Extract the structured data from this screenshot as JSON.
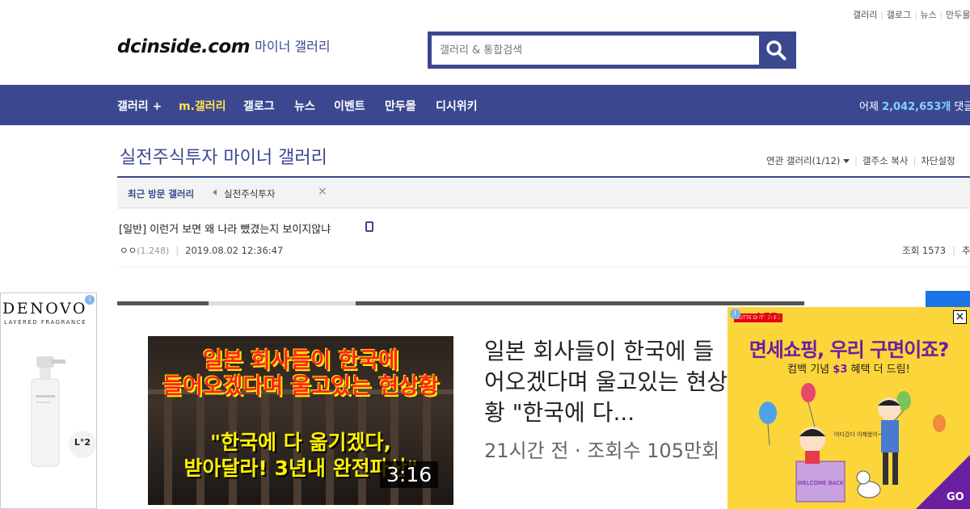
{
  "top_links": [
    "갤러리",
    "갤로그",
    "뉴스",
    "만두몰"
  ],
  "logo": {
    "main": "dcinside.com",
    "sub": "마이너 갤러리"
  },
  "search": {
    "placeholder": "갤러리 & 통합검색",
    "icon": "search-icon"
  },
  "nav": {
    "items": [
      "갤러리 +",
      "m.갤러리",
      "갤로그",
      "뉴스",
      "이벤트",
      "만두몰",
      "디시위키"
    ],
    "stats_prefix": "어제",
    "stats_count": "2,042,653개",
    "stats_suffix": "댓글",
    "active_color": "#ffe14d"
  },
  "gallery": {
    "title": "실전주식투자 마이너 갤러리",
    "tools": [
      "연관 갤러리(1/12)",
      "갤주소 복사",
      "차단설정"
    ]
  },
  "recent": {
    "label": "최근 방문 갤러리",
    "item": "실전주식투자",
    "close": "×"
  },
  "post": {
    "title": "[일반] 이런거 보면 왜 나라 뺐겼는지 보이지않냐",
    "author": "ㅇㅇ",
    "ip": "(1.248)",
    "date": "2019.08.02 12:36:47",
    "views_label": "조회 1573",
    "extra": "추"
  },
  "ad_left": {
    "brand": "DENOVO",
    "sub": "LAYERED FRAGRANCE",
    "badge": "L°2",
    "info": "i"
  },
  "video": {
    "thumb_line1": "일본 회사들이 한국에",
    "thumb_line2": "들어오겠다며 울고있는 현상황",
    "thumb_line3": "\"한국에 다 옮기겠다,",
    "thumb_line4": "받아달라! 3년내 완전파산\"",
    "duration": "3:16",
    "title": "일본 회사들이 한국에 들어오겠다며 울고있는 현상황 \"한국에 다...",
    "meta": "21시간 전 · 조회수 105만회"
  },
  "ad_right": {
    "logo1": "LOTTE DUTY FREE",
    "logo2": "LFD",
    "info": "i",
    "close": "×",
    "headline": "면세쇼핑, 우리 구면이죠?",
    "sub_prefix": "컴백 기념",
    "sub_highlight": "$3",
    "sub_suffix": "혜택 더 드림!",
    "go": "GO",
    "bubble": "어디갔다 이제왔어~",
    "box_label": "WELCOME BACK",
    "brand_color": "#6a1fa0"
  }
}
